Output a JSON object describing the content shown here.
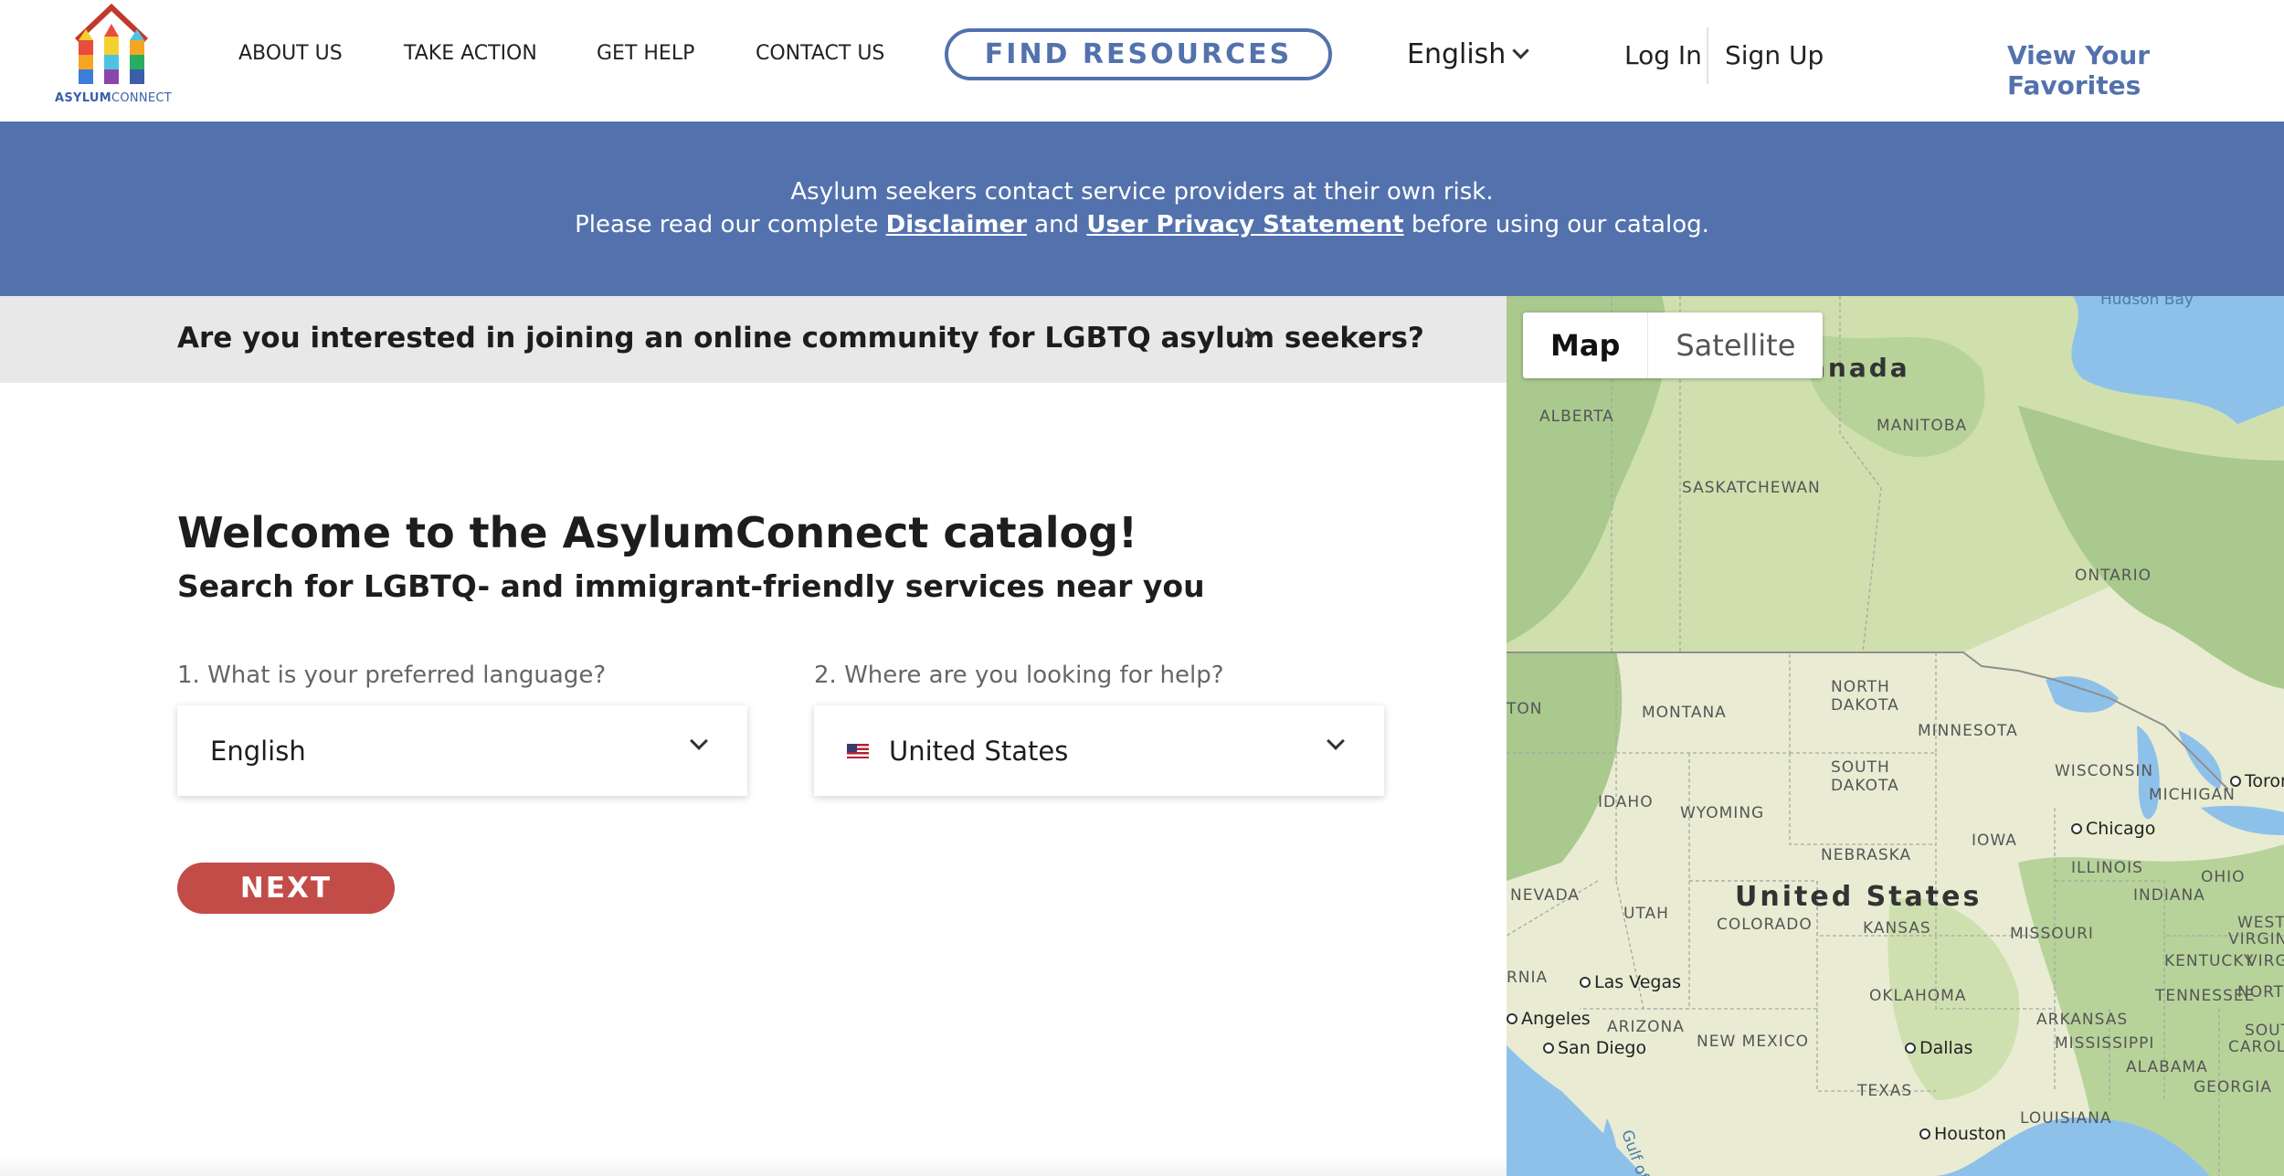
{
  "logo": {
    "text_bold": "ASYLUM",
    "text_regular": "CONNECT"
  },
  "nav": {
    "items": [
      {
        "label": "ABOUT US"
      },
      {
        "label": "TAKE ACTION"
      },
      {
        "label": "GET HELP"
      },
      {
        "label": "CONTACT US"
      }
    ],
    "find_resources": "FIND RESOURCES",
    "language": "English",
    "login": "Log In",
    "signup": "Sign Up",
    "favorites": "View Your Favorites"
  },
  "banner": {
    "line1": "Asylum seekers contact service providers at their own risk.",
    "line2_prefix": "Please read our complete ",
    "disclaimer_link": "Disclaimer",
    "and": " and ",
    "privacy_link": "User Privacy Statement",
    "line2_suffix": " before using our catalog."
  },
  "community": {
    "text": "Are you interested in joining an online community for LGBTQ asylum seekers?"
  },
  "main": {
    "title": "Welcome to the AsylumConnect catalog!",
    "subtitle": "Search for LGBTQ- and immigrant-friendly services near you",
    "q1_label": "1. What is your preferred language?",
    "q1_value": "English",
    "q2_label": "2. Where are you looking for help?",
    "q2_value": "United States",
    "next": "NEXT"
  },
  "map": {
    "toggle_map": "Map",
    "toggle_satellite": "Satellite",
    "labels": {
      "canada": "anada",
      "hudson_bay": "Hudson Bay",
      "alberta": "ALBERTA",
      "manitoba": "MANITOBA",
      "saskatchewan": "SASKATCHEWAN",
      "ontario": "ONTARIO",
      "north_dakota_1": "NORTH",
      "north_dakota_2": "DAKOTA",
      "montana": "MONTANA",
      "minnesota": "MINNESOTA",
      "ton": "TON",
      "south_dakota_1": "SOUTH",
      "south_dakota_2": "DAKOTA",
      "wisconsin": "WISCONSIN",
      "michigan": "MICHIGAN",
      "toronto": "Toront",
      "idaho": "IDAHO",
      "wyoming": "WYOMING",
      "iowa": "IOWA",
      "chicago": "Chicago",
      "nebraska": "NEBRASKA",
      "illinois": "ILLINOIS",
      "ohio": "OHIO",
      "united_states": "United States",
      "nevada": "NEVADA",
      "utah": "UTAH",
      "colorado": "COLORADO",
      "kansas": "KANSAS",
      "indiana": "INDIANA",
      "missouri": "MISSOURI",
      "west_virginia_1": "WEST",
      "west_virginia_2": "VIRGINIA",
      "kentucky": "KENTUCKY",
      "virgin": "VIRGIN",
      "rnia": "RNIA",
      "las_vegas": "Las Vegas",
      "oklahoma": "OKLAHOMA",
      "tennessee": "TENNESSEE",
      "north_carolina": "NORTH CAROL",
      "los_angeles": "Angeles",
      "arizona": "ARIZONA",
      "arkansas": "ARKANSAS",
      "san_diego": "San Diego",
      "new_mexico": "NEW MEXICO",
      "dallas": "Dallas",
      "mississippi": "MISSISSIPPI",
      "south_carolina_1": "SOUTH",
      "south_carolina_2": "CAROLINA",
      "alabama": "ALABAMA",
      "texas": "TEXAS",
      "georgia": "GEORGIA",
      "louisiana": "LOUISIANA",
      "houston": "Houston",
      "gulf": "Gulf of"
    }
  }
}
